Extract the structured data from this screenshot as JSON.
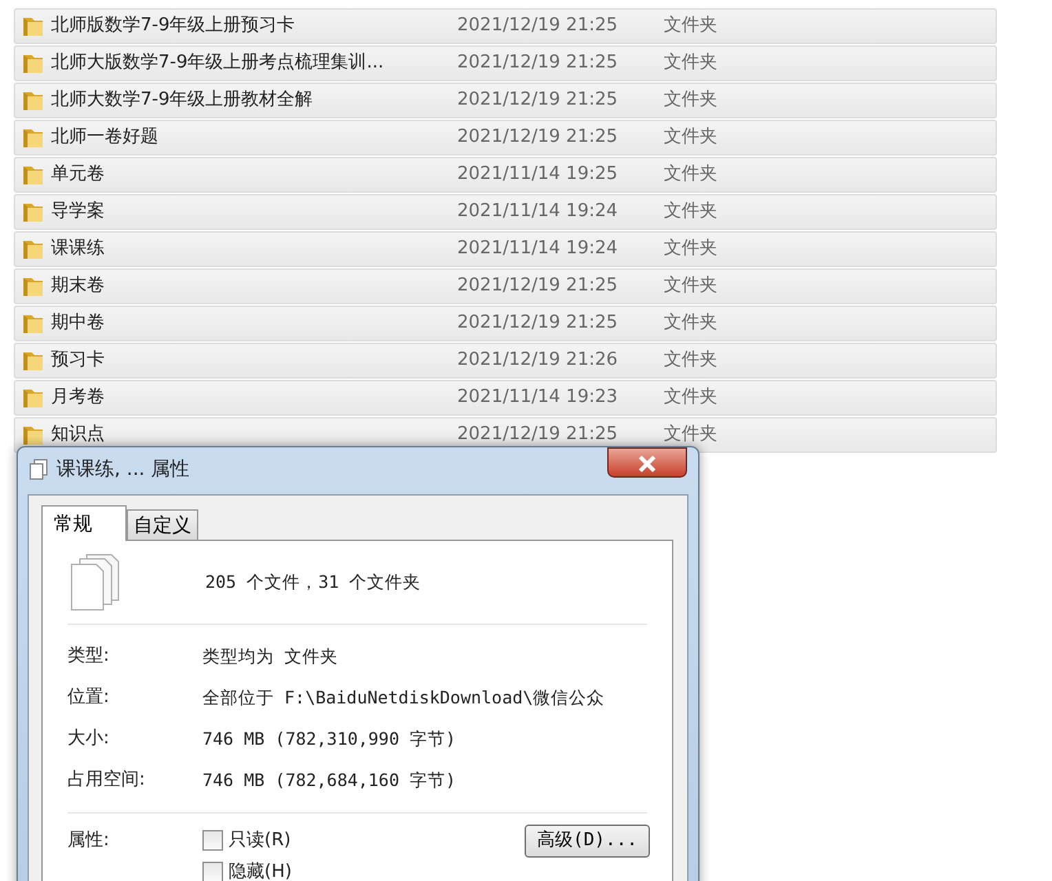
{
  "files": [
    {
      "name": "北师版数学7-9年级上册预习卡",
      "modified": "2021/12/19 21:25",
      "type": "文件夹"
    },
    {
      "name": "北师大版数学7-9年级上册考点梳理集训...",
      "modified": "2021/12/19 21:25",
      "type": "文件夹"
    },
    {
      "name": "北师大数学7-9年级上册教材全解",
      "modified": "2021/12/19 21:25",
      "type": "文件夹"
    },
    {
      "name": "北师一卷好题",
      "modified": "2021/12/19 21:25",
      "type": "文件夹"
    },
    {
      "name": "单元卷",
      "modified": "2021/11/14 19:25",
      "type": "文件夹"
    },
    {
      "name": "导学案",
      "modified": "2021/11/14 19:24",
      "type": "文件夹"
    },
    {
      "name": "课课练",
      "modified": "2021/11/14 19:24",
      "type": "文件夹"
    },
    {
      "name": "期末卷",
      "modified": "2021/12/19 21:25",
      "type": "文件夹"
    },
    {
      "name": "期中卷",
      "modified": "2021/12/19 21:25",
      "type": "文件夹"
    },
    {
      "name": "预习卡",
      "modified": "2021/12/19 21:26",
      "type": "文件夹"
    },
    {
      "name": "月考卷",
      "modified": "2021/11/14 19:23",
      "type": "文件夹"
    },
    {
      "name": "知识点",
      "modified": "2021/12/19 21:25",
      "type": "文件夹"
    }
  ],
  "dialog": {
    "title": "课课练, ... 属性",
    "tabs": [
      {
        "label": "常规",
        "selected": true
      },
      {
        "label": "自定义",
        "selected": false
      }
    ],
    "summary": "205 个文件，31 个文件夹",
    "properties": [
      {
        "label": "类型:",
        "value": "类型均为 文件夹"
      },
      {
        "label": "位置:",
        "value": "全部位于 F:\\BaiduNetdiskDownload\\微信公众"
      },
      {
        "label": "大小:",
        "value": "746 MB (782,310,990 字节)"
      },
      {
        "label": "占用空间:",
        "value": "746 MB (782,684,160 字节)"
      }
    ],
    "attributes_label": "属性:",
    "attributes": [
      {
        "label": "只读(R)",
        "checked": false
      },
      {
        "label": "隐藏(H)",
        "checked": false
      }
    ],
    "advanced_button": "高级(D)..."
  }
}
